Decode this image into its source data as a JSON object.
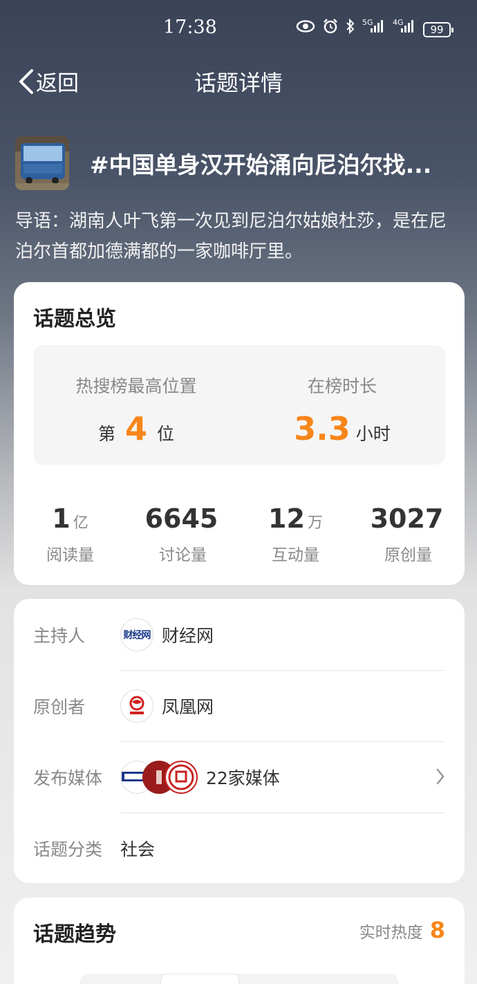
{
  "status": {
    "time": "17:38",
    "battery": "99",
    "net1": "5G",
    "net2": "4G",
    "icons": [
      "eye-icon",
      "alarm-icon",
      "bluetooth-icon",
      "signal-5g-icon",
      "signal-4g-icon",
      "battery-icon"
    ]
  },
  "nav": {
    "back_label": "返回",
    "title": "话题详情"
  },
  "topic": {
    "title": "#中国单身汉开始涌向尼泊尔找...",
    "intro": "导语：湖南人叶飞第一次见到尼泊尔姑娘杜莎，是在尼泊尔首都加德满都的一家咖啡厅里。"
  },
  "overview": {
    "title": "话题总览",
    "rank": {
      "label": "热搜榜最高位置",
      "prefix": "第",
      "value": "4",
      "suffix": "位"
    },
    "duration": {
      "label": "在榜时长",
      "value": "3.3",
      "unit": "小时"
    },
    "stats": [
      {
        "value": "1",
        "unit": "亿",
        "label": "阅读量"
      },
      {
        "value": "6645",
        "unit": "",
        "label": "讨论量"
      },
      {
        "value": "12",
        "unit": "万",
        "label": "互动量"
      },
      {
        "value": "3027",
        "unit": "",
        "label": "原创量"
      }
    ]
  },
  "info": {
    "host_label": "主持人",
    "host_name": "财经网",
    "host_logo_text": "财经网",
    "creator_label": "原创者",
    "creator_name": "凤凰网",
    "media_label": "发布媒体",
    "media_value": "22家媒体",
    "category_label": "话题分类",
    "category_value": "社会"
  },
  "trend": {
    "title": "话题趋势",
    "heat_label": "实时热度",
    "heat_value": "8"
  },
  "colors": {
    "accent": "#f7861b",
    "card_bg": "#ffffff",
    "muted_text": "#888888"
  }
}
